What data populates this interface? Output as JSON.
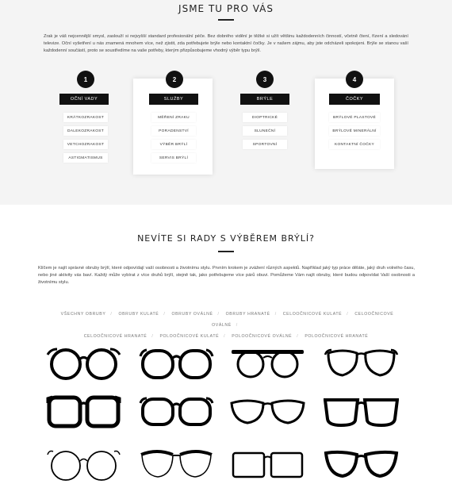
{
  "section1": {
    "title": "JSME TU PRO VÁS",
    "intro": "Zrak je váš nejcennější smysl, zaslouží si nejvyšší standard profesionální péče. Bez dobrého vidění je těžké si užít většinu každodenních činností, včetně čtení, řízení a sledování televize. Oční vyšetření u nás znamená mnohem více, než zjistit, zda potřebujete brýle nebo kontaktní čočky. Je v našem zájmu, aby jste odcházeli spokojeni. Brýle se stanou vaší každodenní součástí, proto se soustředíme na vaše potřeby, kterým přizpůsobujeme vhodný výběr typu brýlí.",
    "cards": [
      {
        "number": "1",
        "title": "OČNÍ VADY",
        "items": [
          "KRÁTKOZRAKOST",
          "DALEKOZRAKOST",
          "VETCHOZRAKOST",
          "ASTIGMATISMUS"
        ]
      },
      {
        "number": "2",
        "title": "SLUŽBY",
        "items": [
          "MĚŘENÍ ZRAKU",
          "PORADENSTVÍ",
          "VÝBĚR BRÝLÍ",
          "SERVIS BRÝLÍ"
        ]
      },
      {
        "number": "3",
        "title": "BRÝLE",
        "items": [
          "DIOPTRICKÉ",
          "SLUNEČNÍ",
          "SPORTOVNÍ"
        ]
      },
      {
        "number": "4",
        "title": "ČOČKY",
        "items": [
          "BRÝLOVÉ PLASTOVÉ",
          "BRÝLOVÉ MINERÁLNÍ",
          "KONTAKTNÍ ČOČKY"
        ]
      }
    ]
  },
  "section2": {
    "title": "NEVÍTE SI RADY S VÝBĚREM BRÝLÍ?",
    "intro": "Klíčem je najít správné obruby brýlí, které odpovídají vaší osobnosti a životnímu stylu. Prvním krokem je zvážení různých aspektů. Například jaký typ práce děláte, jaký druh volného času, nebo jiné aktivity vás baví. Každý může vybírat z více druhů brýlí, stejně tak, jako potřebujeme více párů obuvi. Pomůžeme Vám najít obruby, které budou odpovídat Vaší osobnosti a životnímu stylu.",
    "filters_row1": [
      "VŠECHNY OBRUBY",
      "OBRUBY KULATÉ",
      "OBRUBY OVÁLNÉ",
      "OBRUBY HRANATÉ",
      "CELOOČNICOVÉ KULATÉ",
      "CELOOČNICOVÉ OVÁLNÉ"
    ],
    "filters_row2": [
      "CELOOČNICOVÉ HRANATÉ",
      "POLOOČNICOVÉ KULATÉ",
      "POLOOČNICOVÉ OVÁLNÉ",
      "POLOOČNICOVÉ HRANATÉ"
    ],
    "glasses": [
      {
        "shape": "round-thick"
      },
      {
        "shape": "oval-thick"
      },
      {
        "shape": "browline-round"
      },
      {
        "shape": "oval-thin"
      },
      {
        "shape": "square-thick"
      },
      {
        "shape": "rect-rounded"
      },
      {
        "shape": "cateye-thin"
      },
      {
        "shape": "wayfarer"
      },
      {
        "shape": "round-wire"
      },
      {
        "shape": "browline-thin"
      },
      {
        "shape": "rect-thin"
      },
      {
        "shape": "cateye-thick"
      }
    ]
  }
}
